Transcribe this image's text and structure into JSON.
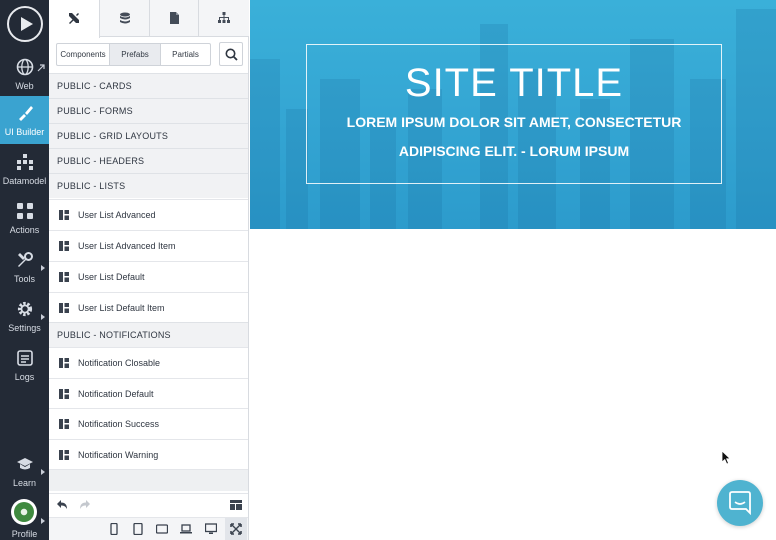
{
  "nav": {
    "items": [
      {
        "label": "Web",
        "icon": "globe-icon"
      },
      {
        "label": "UI Builder",
        "icon": "brush-icon"
      },
      {
        "label": "Datamodel",
        "icon": "hierarchy-icon"
      },
      {
        "label": "Actions",
        "icon": "actions-icon"
      },
      {
        "label": "Tools",
        "icon": "tools-icon"
      },
      {
        "label": "Settings",
        "icon": "gear-icon"
      },
      {
        "label": "Logs",
        "icon": "log-icon"
      },
      {
        "label": "Learn",
        "icon": "graduation-cap-icon"
      },
      {
        "label": "Profile",
        "icon": "avatar"
      }
    ],
    "active_index": 1,
    "colors": {
      "rail_bg": "#232a36",
      "active_bg": "#3aa3d0"
    }
  },
  "panel": {
    "subtabs": [
      "Components",
      "Prefabs",
      "Partials"
    ],
    "active_subtab": "Prefabs",
    "list": [
      {
        "type": "group",
        "label": "PUBLIC - CARDS"
      },
      {
        "type": "group",
        "label": "PUBLIC - FORMS"
      },
      {
        "type": "group",
        "label": "PUBLIC - GRID LAYOUTS"
      },
      {
        "type": "group",
        "label": "PUBLIC - HEADERS"
      },
      {
        "type": "group",
        "label": "PUBLIC - LISTS"
      },
      {
        "type": "item",
        "label": "User List Advanced"
      },
      {
        "type": "item",
        "label": "User List Advanced Item"
      },
      {
        "type": "item",
        "label": "User List Default"
      },
      {
        "type": "item",
        "label": "User List Default Item"
      },
      {
        "type": "group",
        "label": "PUBLIC - NOTIFICATIONS"
      },
      {
        "type": "item",
        "label": "Notification Closable"
      },
      {
        "type": "item",
        "label": "Notification Default"
      },
      {
        "type": "item",
        "label": "Notification Success"
      },
      {
        "type": "item",
        "label": "Notification Warning"
      }
    ]
  },
  "hero": {
    "title": "SITE TITLE",
    "subtitle_line1": "LOREM IPSUM DOLOR SIT AMET, CONSECTETUR",
    "subtitle_line2": "ADIPISCING ELIT. - LORUM IPSUM",
    "color": "#35a7d4"
  },
  "chat": {
    "color": "#4fb3d0"
  }
}
